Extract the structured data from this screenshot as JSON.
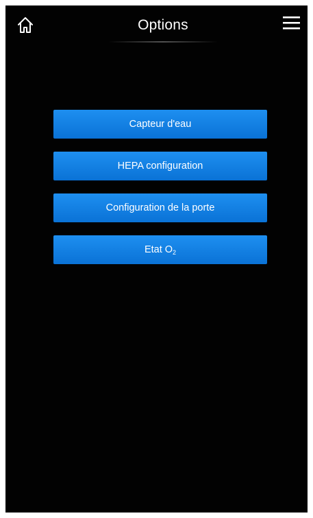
{
  "header": {
    "title": "Options",
    "home_icon": "home-icon",
    "menu_icon": "hamburger-menu-icon"
  },
  "options": [
    {
      "label": "Capteur d'eau"
    },
    {
      "label": "HEPA configuration"
    },
    {
      "label": "Configuration de la porte"
    },
    {
      "label": "Etat O",
      "subscript": "2"
    }
  ],
  "colors": {
    "background": "#020202",
    "button": "#0f7fe2",
    "text": "#ffffff"
  }
}
